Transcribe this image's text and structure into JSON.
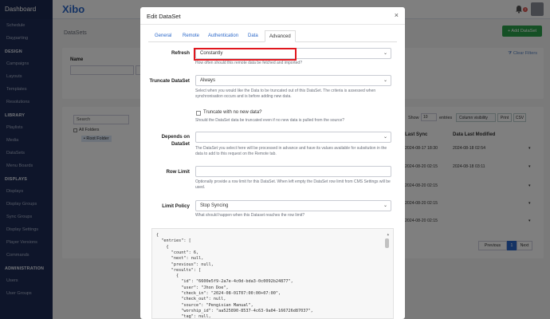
{
  "sidebar": {
    "brand": "Dashboard",
    "items": [
      {
        "type": "item",
        "label": "Schedule"
      },
      {
        "type": "item",
        "label": "Dayparting"
      },
      {
        "type": "head",
        "label": "DESIGN"
      },
      {
        "type": "item",
        "label": "Campaigns"
      },
      {
        "type": "item",
        "label": "Layouts"
      },
      {
        "type": "item",
        "label": "Templates"
      },
      {
        "type": "item",
        "label": "Resolutions"
      },
      {
        "type": "head",
        "label": "LIBRARY"
      },
      {
        "type": "item",
        "label": "Playlists"
      },
      {
        "type": "item",
        "label": "Media"
      },
      {
        "type": "item",
        "label": "DataSets"
      },
      {
        "type": "item",
        "label": "Menu Boards"
      },
      {
        "type": "head",
        "label": "DISPLAYS"
      },
      {
        "type": "item",
        "label": "Displays"
      },
      {
        "type": "item",
        "label": "Display Groups"
      },
      {
        "type": "item",
        "label": "Sync Groups"
      },
      {
        "type": "item",
        "label": "Display Settings"
      },
      {
        "type": "item",
        "label": "Player Versions"
      },
      {
        "type": "item",
        "label": "Commands"
      },
      {
        "type": "head",
        "label": "ADMINISTRATION"
      },
      {
        "type": "item",
        "label": "Users"
      },
      {
        "type": "item",
        "label": "User Groups"
      }
    ]
  },
  "topbar": {
    "logo": "Xibo",
    "badge": "2"
  },
  "page": {
    "title": "DataSets",
    "add_button": "+ Add DataSet",
    "clear_filters": "Clear Filters",
    "name_label": "Name",
    "tree_search_placeholder": "Search",
    "all_folders": "All Folders",
    "root_folder": "Root Folder",
    "show_label": "Show",
    "show_value": "10",
    "entries_label": "entries",
    "column_visibility": "Column visibility",
    "print": "Print",
    "csv": "CSV",
    "col_last_sync": "Last Sync",
    "col_last_modified": "Data Last Modified",
    "rows": [
      {
        "sync": "2024-08-17 18:30",
        "modified": "2024-08-18 02:54"
      },
      {
        "sync": "2024-08-20 02:15",
        "modified": "2024-08-18 03:11"
      },
      {
        "sync": "2024-08-20 02:15",
        "modified": ""
      },
      {
        "sync": "2024-08-20 02:15",
        "modified": ""
      },
      {
        "sync": "2024-08-20 02:15",
        "modified": ""
      }
    ],
    "pagination": {
      "previous": "Previous",
      "current": "1",
      "next": "Next"
    }
  },
  "modal": {
    "title": "Edit DataSet",
    "close": "×",
    "tabs": [
      "General",
      "Remote",
      "Authentication",
      "Data",
      "Advanced"
    ],
    "active_tab": "Advanced",
    "refresh": {
      "label": "Refresh",
      "value": "Constantly",
      "help": "How often should this remote data be fetched and imported?"
    },
    "truncate": {
      "label": "Truncate DataSet",
      "value": "Always",
      "help": "Select when you would like the Data to be truncated out of this DataSet. The criteria is assessed when synchronisation occurs and is before adding new data.",
      "checkbox_label": "Truncate with no new data?",
      "checkbox_help": "Should the DataSet data be truncated even if no new data is pulled from the source?"
    },
    "depends": {
      "label": "Depends on DataSet",
      "value": "",
      "help": "The DataSet you select here will be processed in advance and have its values available for subsitution in the data to add to this request on the Remote tab."
    },
    "row_limit": {
      "label": "Row Limit",
      "value": "",
      "help": "Optionally provide a row limit for this DataSet. When left empty the DataSet row limit from CMS Settings will be used."
    },
    "limit_policy": {
      "label": "Limit Policy",
      "value": "Stop Syncing",
      "help": "What should happen when this Dataset reaches the row limit?"
    },
    "code_lines": [
      "{",
      "  \"entries\": [",
      "    {",
      "      \"count\": 6,",
      "      \"next\": null,",
      "      \"previous\": null,",
      "      \"results\": [",
      "        {",
      "          \"id\": \"6600e5f9-2a7e-4c0d-bda3-0c0092b24877\",",
      "          \"user\": \"Jhon Doe\",",
      "          \"check_in\": \"2024-08-01T07:00:00+07:00\",",
      "          \"check_out\": null,",
      "          \"source\": \"Pengisian Manual\",",
      "          \"worship_id\": \"aa525890-8537-4c63-9a04-166726d87037\",",
      "          \"tag\": null,"
    ]
  }
}
